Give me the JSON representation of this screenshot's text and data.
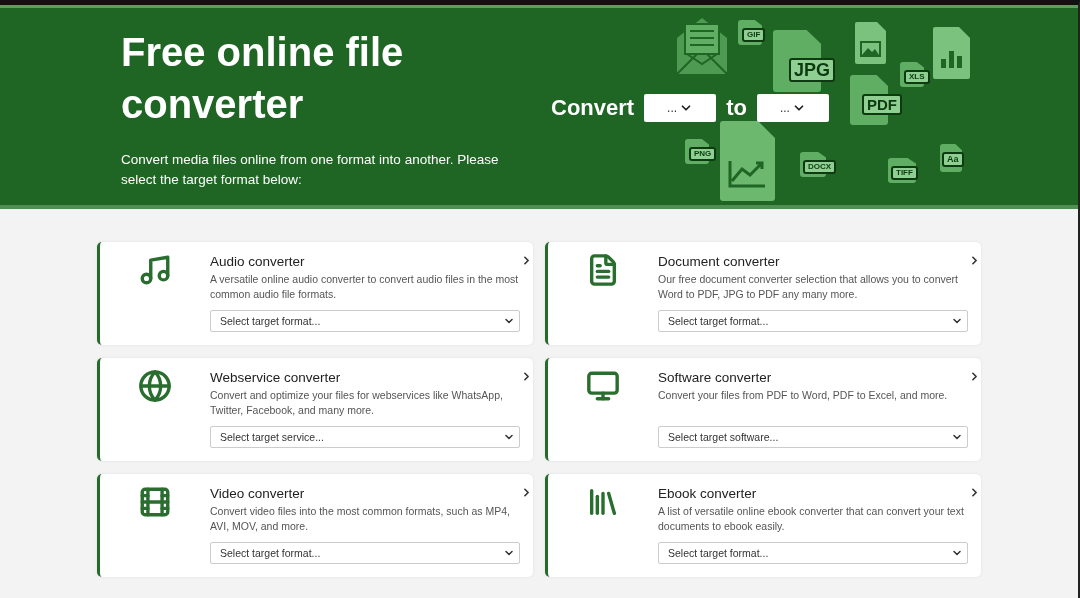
{
  "header": {
    "title": "Free online file converter",
    "subtitle": "Convert media files online from one format into another. Please select the target format below:",
    "convert_label": "Convert",
    "from_select": "...",
    "to_label": "to",
    "to_select": "..."
  },
  "banner_art": [
    {
      "kind": "envelope"
    },
    {
      "kind": "file",
      "label": "GIF"
    },
    {
      "kind": "file",
      "label": "JPG"
    },
    {
      "kind": "image"
    },
    {
      "kind": "barchart"
    },
    {
      "kind": "file",
      "label": "XLS"
    },
    {
      "kind": "file",
      "label": "PDF"
    },
    {
      "kind": "file",
      "label": "PNG"
    },
    {
      "kind": "linechart"
    },
    {
      "kind": "file",
      "label": "DOCX"
    },
    {
      "kind": "file",
      "label": "TIFF"
    },
    {
      "kind": "file",
      "label": "Aa"
    }
  ],
  "cards": [
    {
      "kind": "audio",
      "title": "Audio converter",
      "description": "A versatile online audio converter to convert audio files in the most common audio file formats.",
      "select": "Select target format..."
    },
    {
      "kind": "document",
      "title": "Document converter",
      "description": "Our free document converter selection that allows you to convert Word to PDF, JPG to PDF any many more.",
      "select": "Select target format..."
    },
    {
      "kind": "webservice",
      "title": "Webservice converter",
      "description": "Convert and optimize your files for webservices like WhatsApp, Twitter, Facebook, and many more.",
      "select": "Select target service..."
    },
    {
      "kind": "software",
      "title": "Software converter",
      "description": "Convert your files from PDF to Word, PDF to Excel, and more.",
      "select": "Select target software..."
    },
    {
      "kind": "video",
      "title": "Video converter",
      "description": "Convert video files into the most common formats, such as MP4, AVI, MOV, and more.",
      "select": "Select target format..."
    },
    {
      "kind": "ebook",
      "title": "Ebook converter",
      "description": "A list of versatile online ebook converter that can convert your text documents to ebook easily.",
      "select": "Select target format..."
    }
  ]
}
